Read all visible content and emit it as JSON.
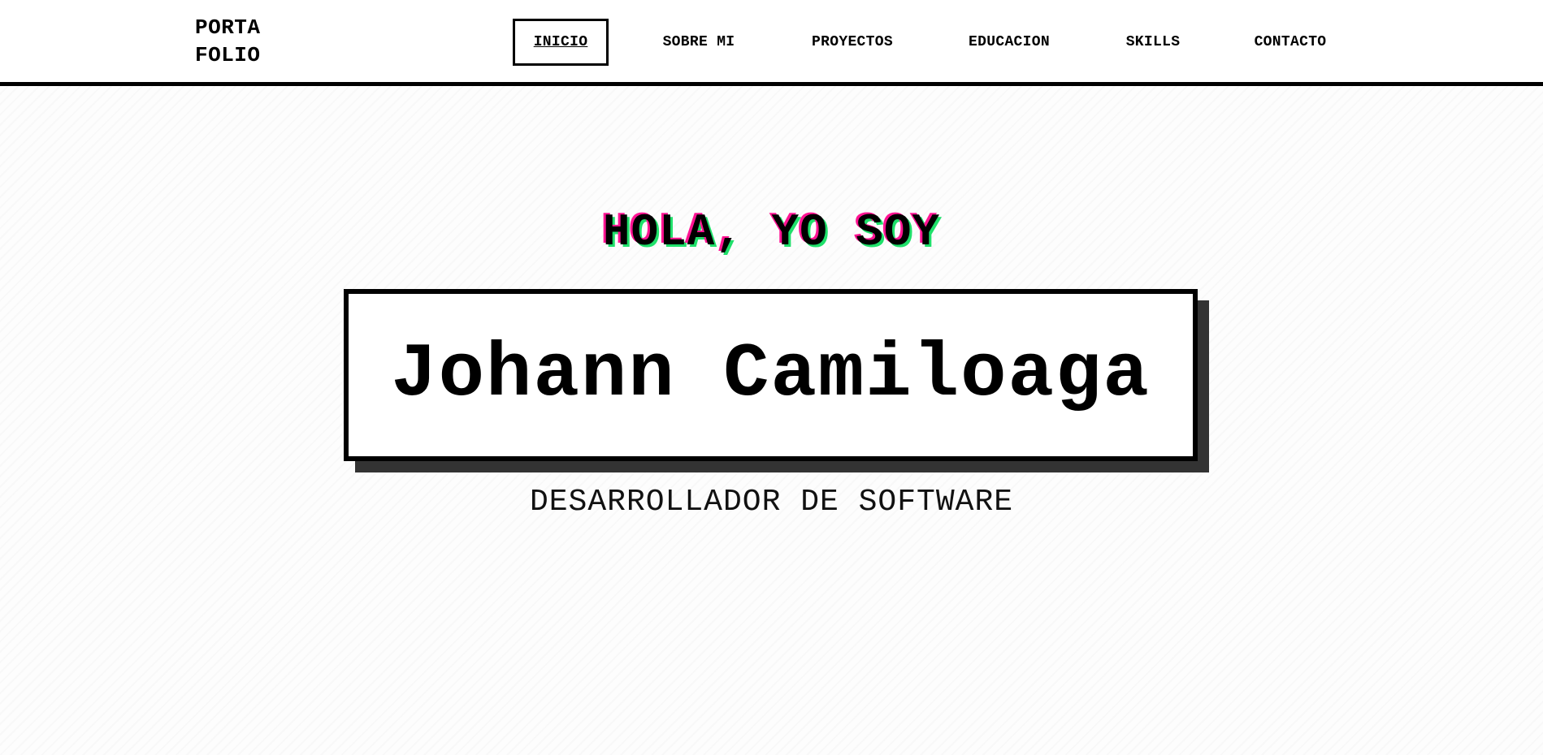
{
  "header": {
    "logo_line1": "PORTA",
    "logo_line2": "FOLIO"
  },
  "nav": {
    "items": [
      {
        "label": "INICIO",
        "active": true
      },
      {
        "label": "SOBRE MI",
        "active": false
      },
      {
        "label": "PROYECTOS",
        "active": false
      },
      {
        "label": "EDUCACION",
        "active": false
      },
      {
        "label": "SKILLS",
        "active": false
      },
      {
        "label": "CONTACTO",
        "active": false
      }
    ]
  },
  "hero": {
    "greeting": "HOLA, YO SOY",
    "name": "Johann Camiloaga",
    "role": "DESARROLLADOR DE SOFTWARE"
  },
  "colors": {
    "greeting_shadow_pink": "#ff1493",
    "greeting_shadow_green": "#1fe06a",
    "box_shadow": "#333333"
  }
}
